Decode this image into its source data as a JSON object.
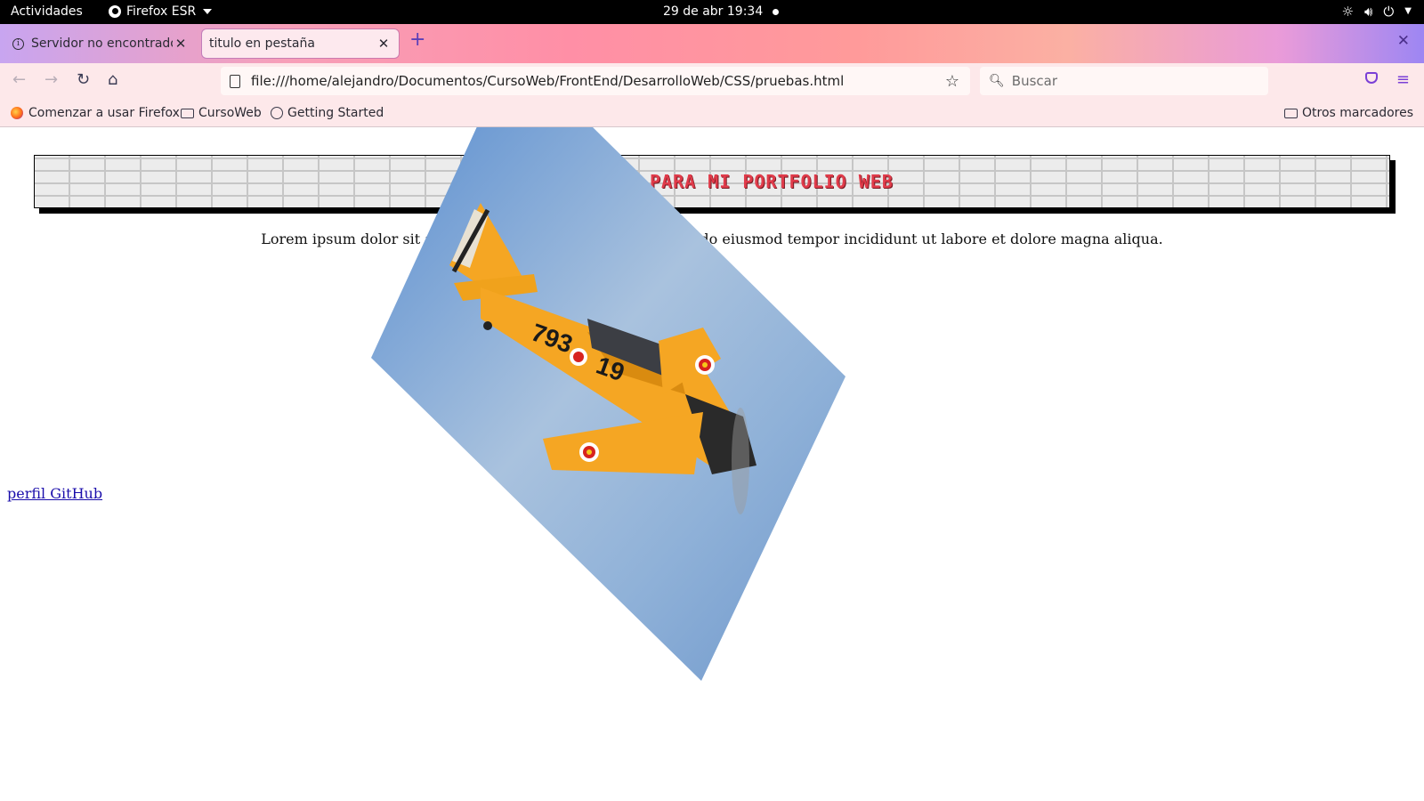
{
  "system_bar": {
    "activities": "Actividades",
    "app_name": "Firefox ESR",
    "clock": "29 de abr  19:34"
  },
  "tabs": [
    {
      "title": "Servidor no encontrado",
      "active": false
    },
    {
      "title": "titulo en pestaña",
      "active": true
    }
  ],
  "navigation": {
    "url": "file:///home/alejandro/Documentos/CursoWeb/FrontEnd/DesarrolloWeb/CSS/pruebas.html",
    "search_placeholder": "Buscar"
  },
  "bookmarks": {
    "items": [
      "Comenzar a usar Firefox",
      "CursoWeb",
      "Getting Started"
    ],
    "other": "Otros marcadores"
  },
  "page": {
    "banner_title": "Para mi portfolio web",
    "paragraph": "Lorem ipsum dolor sit amet, consectetur adipiscing elit, sed do eiusmod tempor incididunt ut labore et dolore magna aliqua.",
    "link": "perfil GitHub",
    "airplane_number": "793",
    "airplane_number_2": "19"
  },
  "colors": {
    "accent": "#7a3fd6",
    "banner_text": "#e03b4a",
    "sky": "#7ea3cf",
    "plane": "#f5a623"
  }
}
